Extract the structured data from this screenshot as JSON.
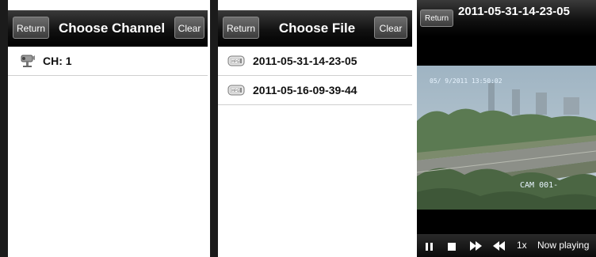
{
  "channel_screen": {
    "return_label": "Return",
    "title": "Choose Channel",
    "clear_label": "Clear",
    "items": [
      {
        "label": "CH: 1",
        "icon": "cctv-camera-icon"
      }
    ]
  },
  "file_screen": {
    "return_label": "Return",
    "title": "Choose File",
    "clear_label": "Clear",
    "items": [
      {
        "label": "2011-05-31-14-23-05",
        "icon": "mpg-file-icon"
      },
      {
        "label": "2011-05-16-09-39-44",
        "icon": "mpg-file-icon"
      }
    ]
  },
  "player_screen": {
    "return_label": "Return",
    "title": "2011-05-31-14-23-05",
    "video": {
      "timestamp_overlay": "05/ 9/2011 13:50:02",
      "camera_overlay": "CAM 001-"
    },
    "controls": {
      "speed_label": "1x",
      "status_label": "Now playing"
    }
  },
  "colors": {
    "header_top": "#3a3a3a",
    "header_bottom": "#000000",
    "row_divider": "#cfcfcf"
  }
}
